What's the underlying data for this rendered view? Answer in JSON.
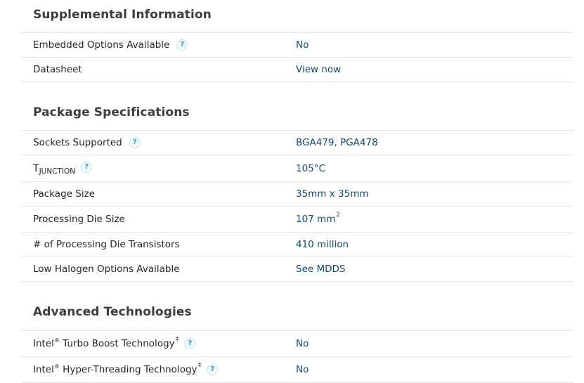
{
  "help_glyph": "?",
  "sections": [
    {
      "title": "Supplemental Information",
      "rows": [
        {
          "label": "Embedded Options Available",
          "value": "No"
        },
        {
          "label": "Datasheet",
          "value": "View now"
        }
      ]
    },
    {
      "title": "Package Specifications",
      "rows": [
        {
          "label": "Sockets Supported",
          "value": "BGA479, PGA478"
        },
        {
          "label_main": "T",
          "label_sub": "JUNCTION",
          "value": "105°C"
        },
        {
          "label": "Package Size",
          "value": "35mm x 35mm"
        },
        {
          "label": "Processing Die Size",
          "value": "107 mm",
          "value_sup": "2"
        },
        {
          "label": "# of Processing Die Transistors",
          "value": "410 million"
        },
        {
          "label": "Low Halogen Options Available",
          "value": "See MDDS"
        }
      ]
    },
    {
      "title": "Advanced Technologies",
      "rows": [
        {
          "label_pre": "Intel",
          "label_reg": "®",
          "label_post": " Turbo Boost Technology ",
          "label_dagger": "‡",
          "value": "No"
        },
        {
          "label_pre": "Intel",
          "label_reg": "®",
          "label_post": " Hyper-Threading Technology ",
          "label_dagger": "‡",
          "value": "No"
        }
      ]
    }
  ]
}
